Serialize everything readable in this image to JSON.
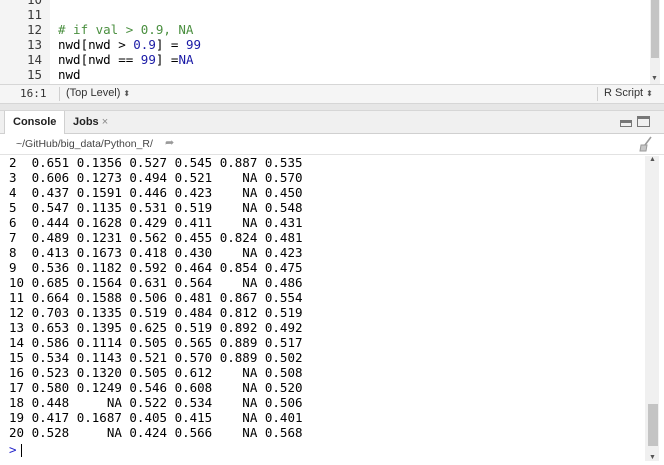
{
  "editor": {
    "lines": [
      {
        "num": "10",
        "segments": []
      },
      {
        "num": "11",
        "segments": []
      },
      {
        "num": "12",
        "segments": [
          {
            "t": "# if val > 0.9, NA",
            "c": "c-comment"
          }
        ]
      },
      {
        "num": "13",
        "segments": [
          {
            "t": "nwd[nwd > ",
            "c": "c-kw"
          },
          {
            "t": "0.9",
            "c": "c-num"
          },
          {
            "t": "] = ",
            "c": "c-kw"
          },
          {
            "t": "99",
            "c": "c-num"
          }
        ]
      },
      {
        "num": "14",
        "segments": [
          {
            "t": "nwd[nwd == ",
            "c": "c-kw"
          },
          {
            "t": "99",
            "c": "c-num"
          },
          {
            "t": "] =",
            "c": "c-kw"
          },
          {
            "t": "NA",
            "c": "c-na"
          }
        ]
      },
      {
        "num": "15",
        "segments": [
          {
            "t": "nwd",
            "c": "c-kw"
          }
        ]
      },
      {
        "num": "16",
        "segments": []
      }
    ]
  },
  "status": {
    "position": "16:1",
    "scope": "(Top Level)",
    "file_type": "R Script"
  },
  "console": {
    "tabs": [
      {
        "label": "Console"
      },
      {
        "label": "Jobs",
        "close": "×"
      }
    ],
    "path": "~/GitHub/big_data/Python_R/",
    "output": [
      "2  0.651 0.1356 0.527 0.545 0.887 0.535",
      "3  0.606 0.1273 0.494 0.521    NA 0.570",
      "4  0.437 0.1591 0.446 0.423    NA 0.450",
      "5  0.547 0.1135 0.531 0.519    NA 0.548",
      "6  0.444 0.1628 0.429 0.411    NA 0.431",
      "7  0.489 0.1231 0.562 0.455 0.824 0.481",
      "8  0.413 0.1673 0.418 0.430    NA 0.423",
      "9  0.536 0.1182 0.592 0.464 0.854 0.475",
      "10 0.685 0.1564 0.631 0.564    NA 0.486",
      "11 0.664 0.1588 0.506 0.481 0.867 0.554",
      "12 0.703 0.1335 0.519 0.484 0.812 0.519",
      "13 0.653 0.1395 0.625 0.519 0.892 0.492",
      "14 0.586 0.1114 0.505 0.565 0.889 0.517",
      "15 0.534 0.1143 0.521 0.570 0.889 0.502",
      "16 0.523 0.1320 0.505 0.612    NA 0.508",
      "17 0.580 0.1249 0.546 0.608    NA 0.520",
      "18 0.448     NA 0.522 0.534    NA 0.506",
      "19 0.417 0.1687 0.405 0.415    NA 0.401",
      "20 0.528     NA 0.424 0.566    NA 0.568"
    ],
    "prompt": ">"
  },
  "icons": {
    "minimize": "minimize-icon",
    "maximize": "maximize-icon",
    "broom": "broom-icon",
    "path_link": "arrow-link-icon"
  }
}
